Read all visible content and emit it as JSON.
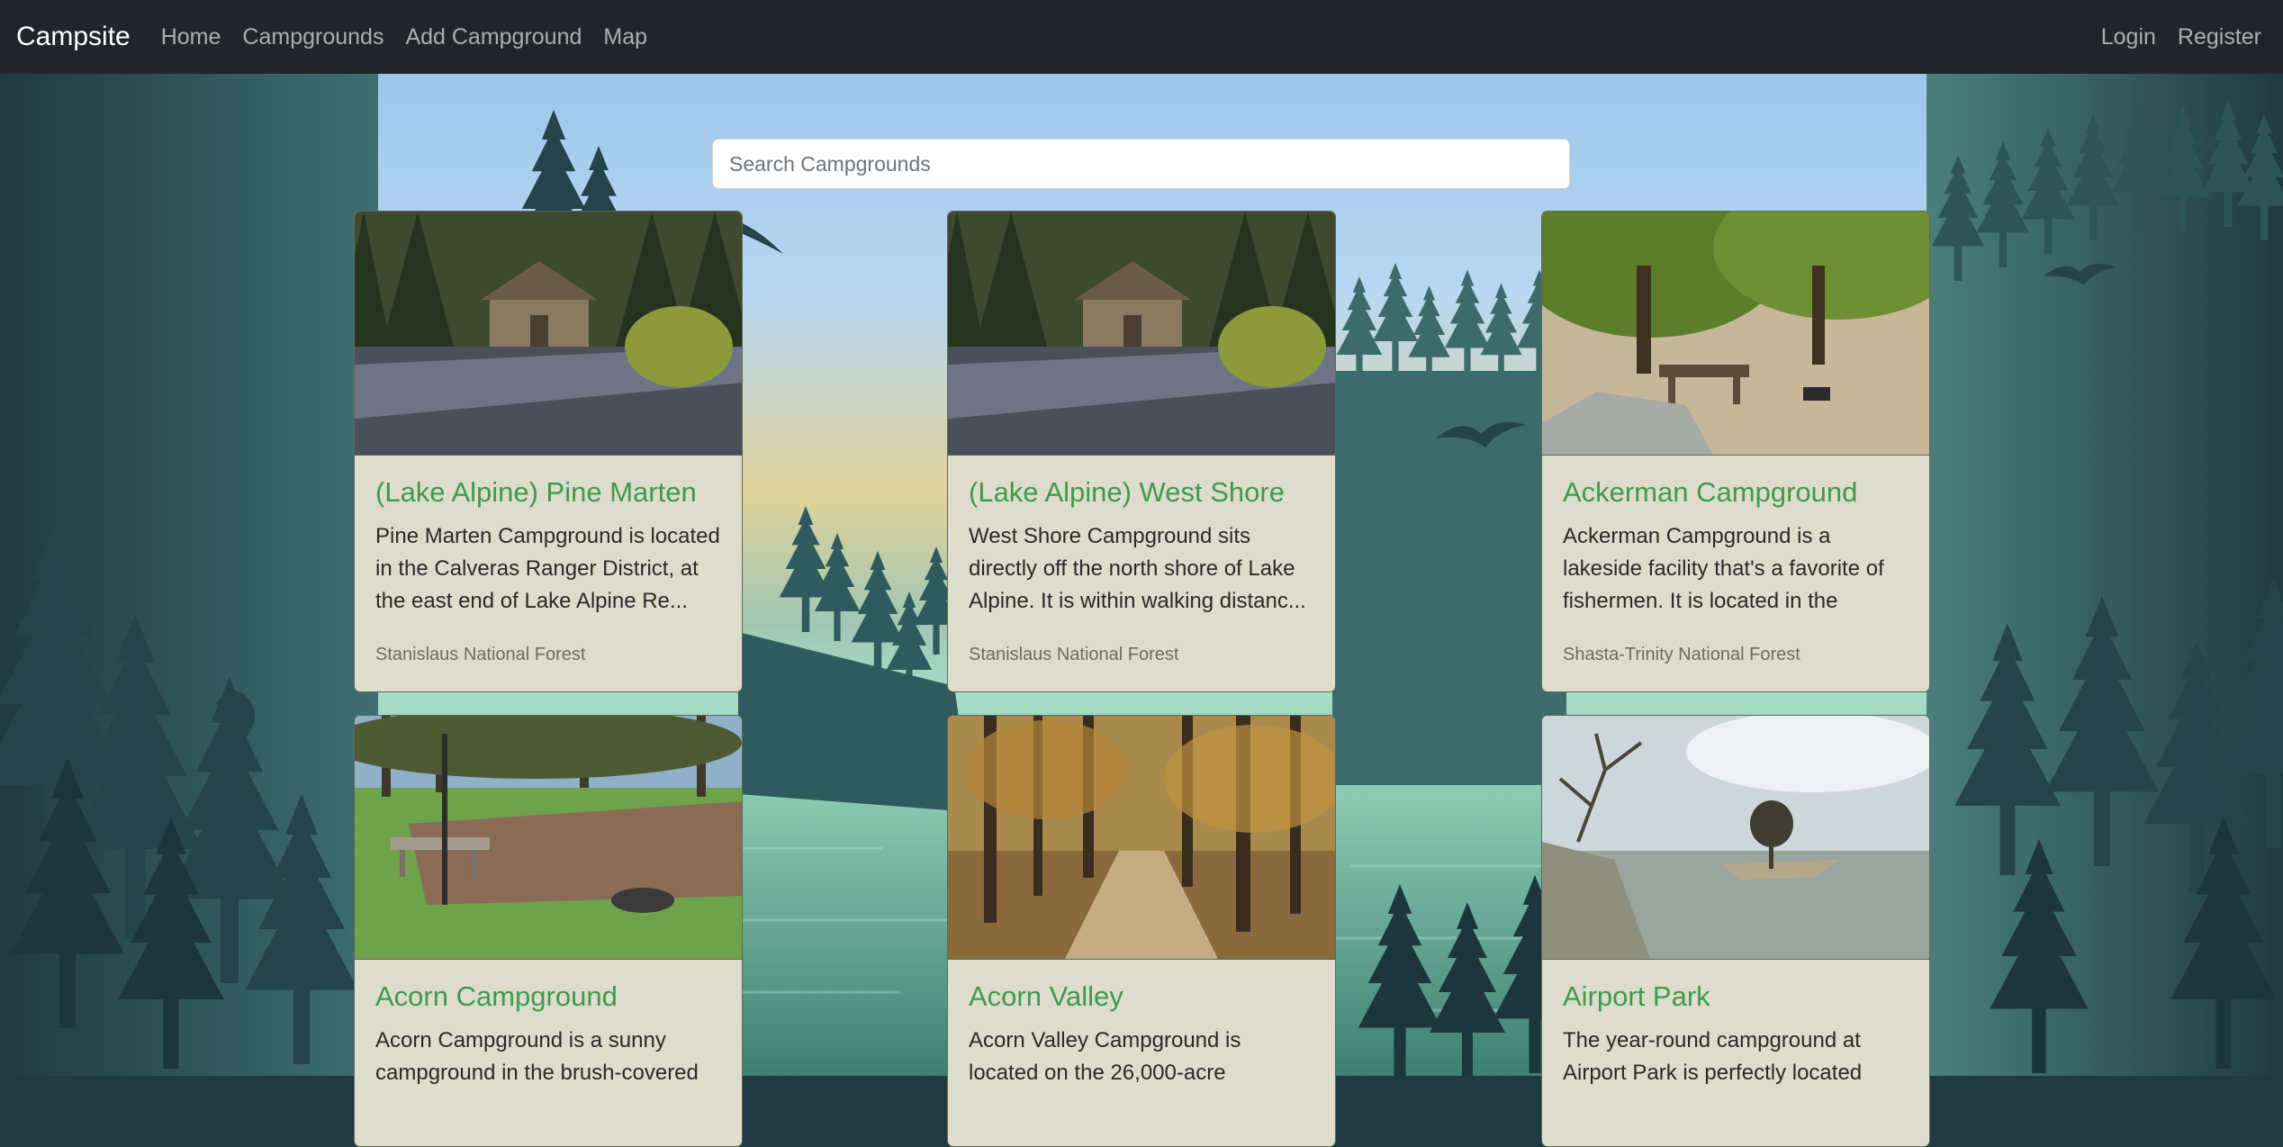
{
  "navbar": {
    "brand": "Campsite",
    "links": [
      "Home",
      "Campgrounds",
      "Add Campground",
      "Map"
    ],
    "right_links": [
      "Login",
      "Register"
    ]
  },
  "search": {
    "placeholder": "Search Campgrounds"
  },
  "campgrounds": [
    {
      "title": "(Lake Alpine) Pine Marten",
      "description": "Pine Marten Campground is located in the Calveras Ranger District, at the east end of Lake Alpine Re...",
      "location": "Stanislaus National Forest",
      "image": "forest-cabin-photo"
    },
    {
      "title": "(Lake Alpine) West Shore",
      "description": "West Shore Campground sits directly off the north shore of Lake Alpine. It is within walking distanc...",
      "location": "Stanislaus National Forest",
      "image": "forest-cabin-photo"
    },
    {
      "title": "Ackerman Campground",
      "description": "Ackerman Campground is a lakeside facility that's a favorite of fishermen. It is located in the beau...",
      "location": "Shasta-Trinity National Forest",
      "image": "picnic-table-shade-photo"
    },
    {
      "title": "Acorn Campground",
      "description": "Acorn Campground is a sunny campground in the brush-covered",
      "location": "",
      "image": "grass-picnic-table-photo"
    },
    {
      "title": "Acorn Valley",
      "description": "Acorn Valley Campground is located on the 26,000-acre",
      "location": "",
      "image": "autumn-trail-photo"
    },
    {
      "title": "Airport Park",
      "description": "The year-round campground at Airport Park is perfectly located",
      "location": "",
      "image": "lake-shore-photo"
    }
  ],
  "colors": {
    "navbar": "#212529",
    "title_green": "#3f9a4e",
    "card_bg": "#deddcd",
    "sky_top": "#9ec6ea",
    "forest_dark": "#1f3a40"
  }
}
